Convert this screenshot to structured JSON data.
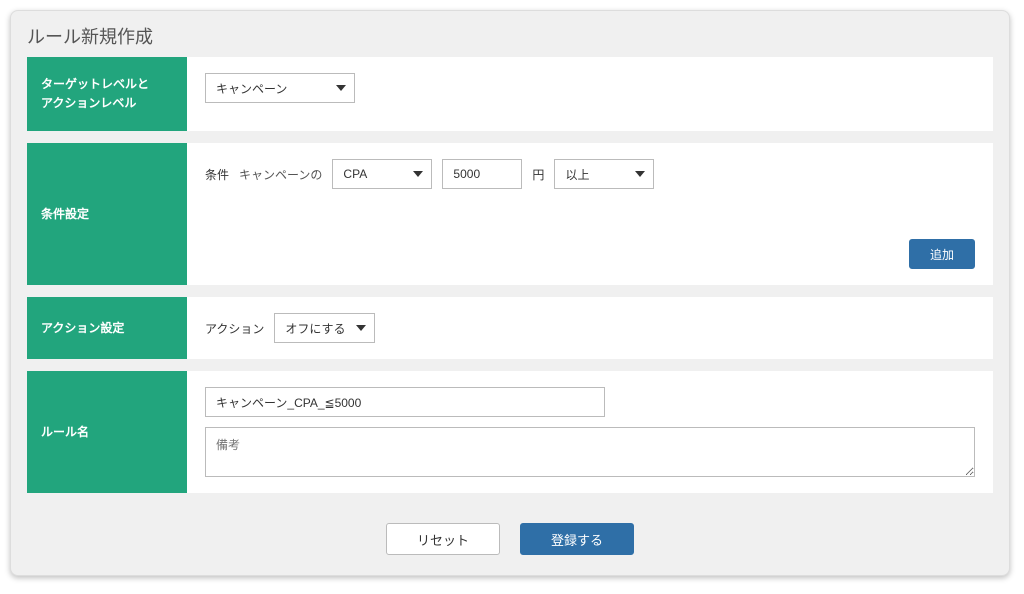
{
  "panel": {
    "title": "ルール新規作成"
  },
  "target_level": {
    "label": "ターゲットレベルと\nアクションレベル",
    "value": "キャンペーン"
  },
  "conditions": {
    "label": "条件設定",
    "row_label": "条件",
    "subject": "キャンペーンの",
    "metric": "CPA",
    "amount": "5000",
    "unit": "円",
    "comparator": "以上",
    "add_button": "追加"
  },
  "action": {
    "label": "アクション設定",
    "row_label": "アクション",
    "value": "オフにする"
  },
  "rule_name": {
    "label": "ルール名",
    "value": "キャンペーン_CPA_≦5000",
    "note_placeholder": "備考"
  },
  "footer": {
    "reset": "リセット",
    "submit": "登録する"
  }
}
